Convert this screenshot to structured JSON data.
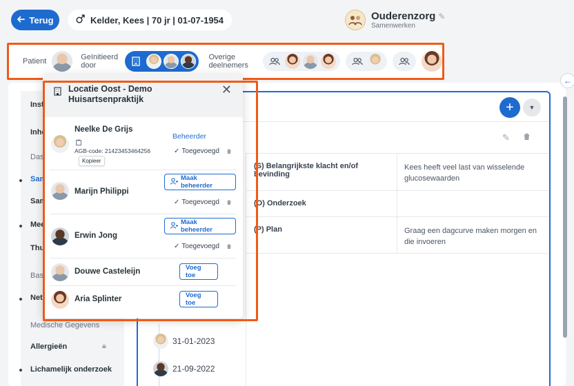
{
  "header": {
    "back_label": "Terug",
    "patient_sex_icon": "male-symbol-icon",
    "patient_label": "Kelder, Kees | 70 jr | 01-07-1954",
    "brand_title": "Ouderenzorg",
    "brand_subtitle": "Samenwerken"
  },
  "participants_bar": {
    "patient_label": "Patient",
    "initiated_label": "Geïnitieerd door",
    "others_label": "Overige deelnemers"
  },
  "sidebar": {
    "items": [
      {
        "label": "Inst"
      },
      {
        "label": "Inho"
      },
      {
        "label": "Dash"
      },
      {
        "label": "Sam"
      },
      {
        "label": "Sam"
      },
      {
        "label": "Mee"
      },
      {
        "label": "Thu"
      },
      {
        "label": "Basi"
      },
      {
        "label": "Net"
      }
    ],
    "category_medical": "Medische Gegevens",
    "allergies": "Allergieën",
    "physical_exam": "Lichamelijk onderzoek"
  },
  "soep": [
    {
      "key": "(S) Belangrijkste klacht en/of bevinding",
      "value": "Kees heeft veel last van wisselende glucosewaarden"
    },
    {
      "key": "(O) Onderzoek",
      "value": ""
    },
    {
      "key": "(P) Plan",
      "value": "Graag een dagcurve maken morgen en die invoeren"
    }
  ],
  "timeline": [
    {
      "date": "31-01-2023"
    },
    {
      "date": "21-09-2022"
    }
  ],
  "popup": {
    "title": "Locatie Oost - Demo Huisartsenpraktijk",
    "members": [
      {
        "name": "Neelke De Grijs",
        "role": "Beheerder",
        "status": "Toegevoegd",
        "agb": "AGB-code: 21423453464256",
        "copy": "Kopieer"
      },
      {
        "name": "Marijn Philippi",
        "action": "Maak beheerder",
        "status": "Toegevoegd"
      },
      {
        "name": "Erwin Jong",
        "action": "Maak beheerder",
        "status": "Toegevoegd"
      },
      {
        "name": "Douwe Casteleijn",
        "action": "Voeg toe"
      },
      {
        "name": "Aria Splinter",
        "action": "Voeg toe"
      }
    ]
  },
  "colors": {
    "accent": "#1e6bd0",
    "highlight": "#f05a16"
  }
}
